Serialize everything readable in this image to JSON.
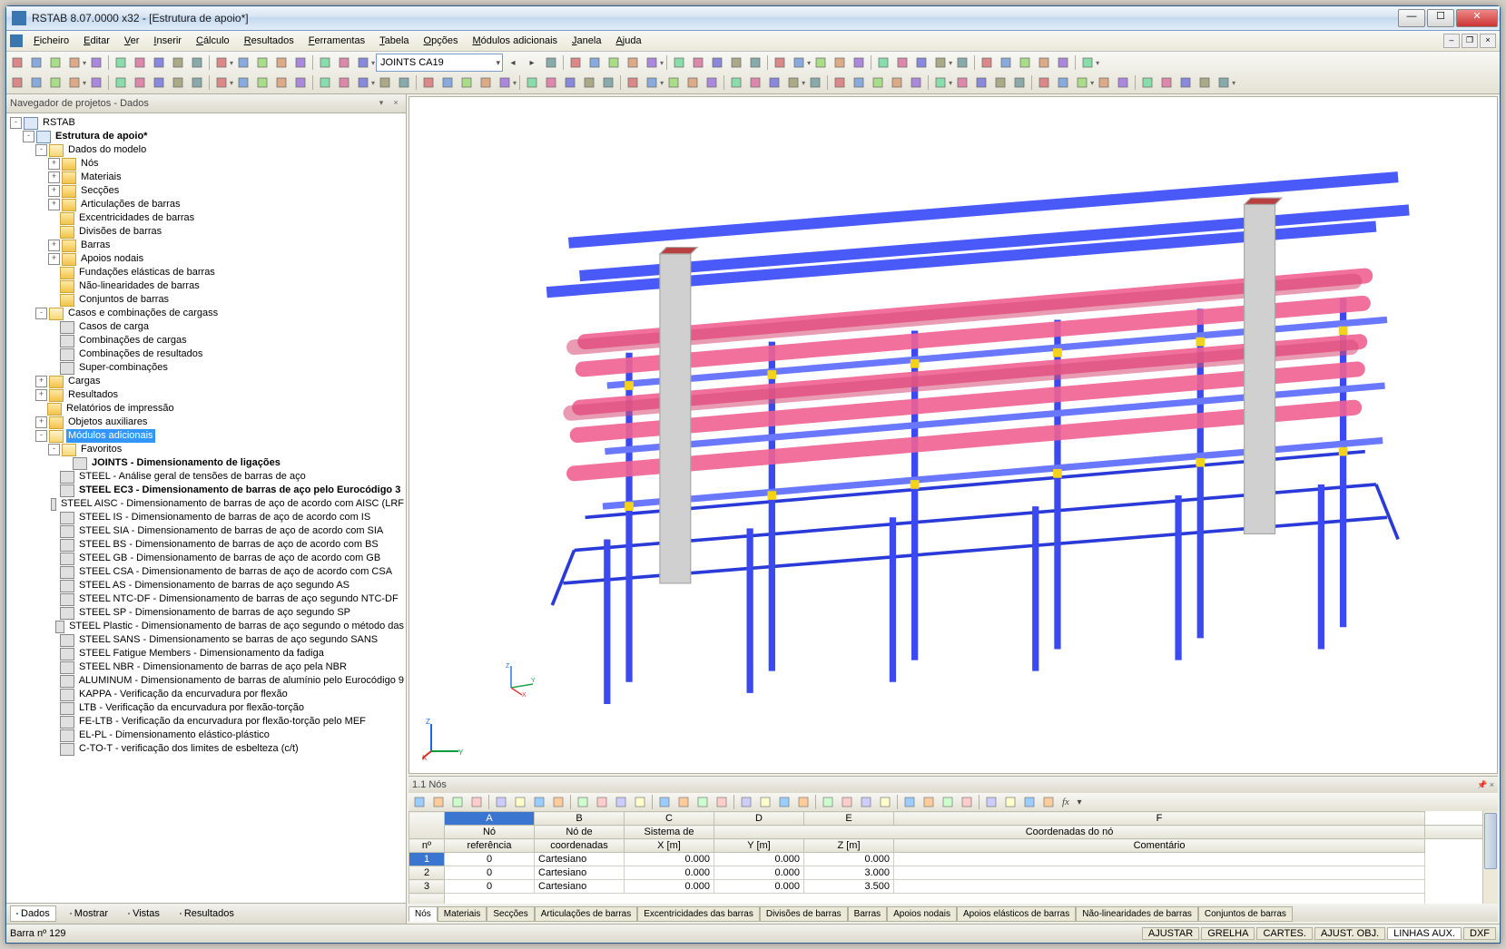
{
  "window": {
    "title": "RSTAB 8.07.0000 x32 - [Estrutura de apoio*]"
  },
  "menu": {
    "items": [
      "Ficheiro",
      "Editar",
      "Ver",
      "Inserir",
      "Cálculo",
      "Resultados",
      "Ferramentas",
      "Tabela",
      "Opções",
      "Módulos adicionais",
      "Janela",
      "Ajuda"
    ]
  },
  "toolbar_combo": "JOINTS CA19",
  "navigator": {
    "title": "Navegador de projetos - Dados",
    "root": "RSTAB",
    "project": "Estrutura de apoio*",
    "model_data_label": "Dados do modelo",
    "model_items": [
      "Nós",
      "Materiais",
      "Secções",
      "Articulações de barras",
      "Excentricidades de barras",
      "Divisões de barras",
      "Barras",
      "Apoios nodais",
      "Fundações elásticas de barras",
      "Não-linearidades de barras",
      "Conjuntos de barras"
    ],
    "loadcases_label": "Casos e combinações de cargass",
    "loadcases_items": [
      "Casos de carga",
      "Combinações de cargas",
      "Combinações de resultados",
      "Super-combinações"
    ],
    "top_items": [
      "Cargas",
      "Resultados",
      "Relatórios de impressão",
      "Objetos auxiliares"
    ],
    "modules_label": "Módulos adicionais",
    "favorites_label": "Favoritos",
    "fav_joint": "JOINTS - Dimensionamento de ligações",
    "modules": [
      "STEEL - Análise geral de tensões de barras de aço",
      "STEEL EC3 - Dimensionamento de barras de aço pelo Eurocódigo 3",
      "STEEL AISC - Dimensionamento de barras de aço de acordo com AISC (LRF",
      "STEEL IS - Dimensionamento de barras de aço de acordo com IS",
      "STEEL SIA - Dimensionamento de barras de aço de acordo com SIA",
      "STEEL BS - Dimensionamento de barras de aço de acordo com BS",
      "STEEL GB - Dimensionamento de barras de aço de acordo com GB",
      "STEEL CSA - Dimensionamento de barras de aço de acordo com CSA",
      "STEEL AS - Dimensionamento de barras de aço segundo AS",
      "STEEL NTC-DF - Dimensionamento de barras de aço segundo NTC-DF",
      "STEEL SP - Dimensionamento de barras de aço segundo SP",
      "STEEL Plastic - Dimensionamento de barras de aço segundo o método das",
      "STEEL SANS - Dimensionamento se barras de aço segundo SANS",
      "STEEL Fatigue Members - Dimensionamento da fadiga",
      "STEEL NBR - Dimensionamento de barras de aço pela NBR",
      "ALUMINUM - Dimensionamento de barras de alumínio pelo Eurocódigo 9",
      "KAPPA - Verificação da encurvadura por flexão",
      "LTB - Verificação da encurvadura por flexão-torção",
      "FE-LTB - Verificação da encurvadura por flexão-torção pelo MEF",
      "EL-PL - Dimensionamento elástico-plástico",
      "C-TO-T - verificação dos limites de esbelteza (c/t)"
    ],
    "tabs": {
      "dados": "Dados",
      "mostrar": "Mostrar",
      "vistas": "Vistas",
      "resultados": "Resultados"
    }
  },
  "bottom_panel": {
    "title": "1.1 Nós",
    "col_letters": [
      "A",
      "B",
      "C",
      "D",
      "E",
      "F"
    ],
    "header_row1": {
      "no": "Nó",
      "ref": "Nó de",
      "sys": "Sistema de",
      "coords": "Coordenadas do nó",
      "comment": ""
    },
    "header_row2": {
      "no": "nº",
      "ref": "referência",
      "sys": "coordenadas",
      "x": "X [m]",
      "y": "Y [m]",
      "z": "Z [m]",
      "comment": "Comentário"
    },
    "rows": [
      {
        "n": "1",
        "ref": "0",
        "sys": "Cartesiano",
        "x": "0.000",
        "y": "0.000",
        "z": "0.000"
      },
      {
        "n": "2",
        "ref": "0",
        "sys": "Cartesiano",
        "x": "0.000",
        "y": "0.000",
        "z": "3.000"
      },
      {
        "n": "3",
        "ref": "0",
        "sys": "Cartesiano",
        "x": "0.000",
        "y": "0.000",
        "z": "3.500"
      }
    ],
    "tabs": [
      "Nós",
      "Materiais",
      "Secções",
      "Articulações de barras",
      "Excentricidades das barras",
      "Divisões de barras",
      "Barras",
      "Apoios nodais",
      "Apoios elásticos de barras",
      "Não-linearidades de barras",
      "Conjuntos de barras"
    ]
  },
  "status": {
    "left": "Barra nº 129",
    "panes": [
      "AJUSTAR",
      "GRELHA",
      "CARTES.",
      "AJUST. OBJ.",
      "LINHAS AUX.",
      "DXF"
    ],
    "active_idx": 4
  }
}
